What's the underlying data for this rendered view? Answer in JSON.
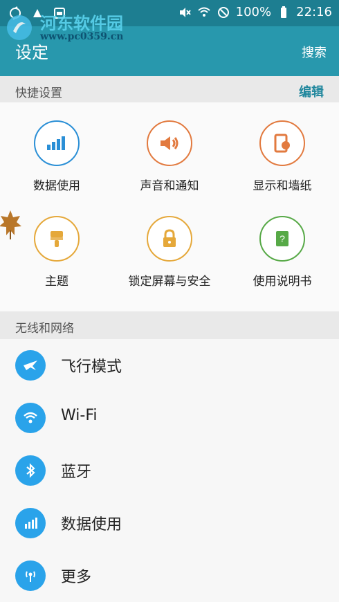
{
  "status": {
    "battery": "100%",
    "time": "22:16"
  },
  "app": {
    "title": "设定",
    "search_label": "搜索",
    "watermark_text": "河东软件园",
    "watermark_url": "www.pc0359.cn"
  },
  "quick_section": {
    "title": "快捷设置",
    "edit_label": "编辑",
    "items": [
      {
        "label": "数据使用",
        "icon": "data-usage-icon",
        "color": "#2a8fd6"
      },
      {
        "label": "声音和通知",
        "icon": "sound-icon",
        "color": "#e27a3f"
      },
      {
        "label": "显示和墙纸",
        "icon": "display-icon",
        "color": "#e27a3f"
      },
      {
        "label": "主题",
        "icon": "theme-icon",
        "color": "#e5a83a"
      },
      {
        "label": "锁定屏幕与安全",
        "icon": "lock-icon",
        "color": "#e5a83a"
      },
      {
        "label": "使用说明书",
        "icon": "manual-icon",
        "color": "#57a947"
      }
    ]
  },
  "network_section": {
    "title": "无线和网络",
    "items": [
      {
        "label": "飞行模式",
        "icon": "airplane-icon"
      },
      {
        "label": "Wi-Fi",
        "icon": "wifi-icon"
      },
      {
        "label": "蓝牙",
        "icon": "bluetooth-icon"
      },
      {
        "label": "数据使用",
        "icon": "data-usage-icon"
      },
      {
        "label": "更多",
        "icon": "more-icon"
      }
    ]
  }
}
